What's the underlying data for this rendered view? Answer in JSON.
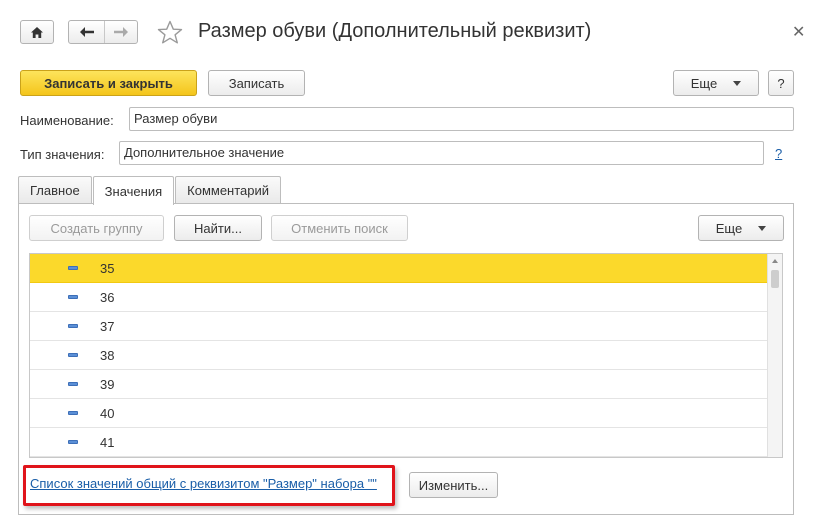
{
  "window": {
    "title": "Размер обуви (Дополнительный реквизит)"
  },
  "toolbar": {
    "save_close_label": "Записать и закрыть",
    "save_label": "Записать",
    "more_label": "Еще",
    "help_label": "?"
  },
  "form": {
    "name_label": "Наименование:",
    "name_value": "Размер обуви",
    "type_label": "Тип значения:",
    "type_value": "Дополнительное значение",
    "type_help": "?"
  },
  "tabs": [
    {
      "label": "Главное"
    },
    {
      "label": "Значения"
    },
    {
      "label": "Комментарий"
    }
  ],
  "values_panel": {
    "create_group_label": "Создать группу",
    "find_label": "Найти...",
    "cancel_search_label": "Отменить поиск",
    "more_label": "Еще",
    "rows": [
      "35",
      "36",
      "37",
      "38",
      "39",
      "40",
      "41"
    ],
    "shared_link_text": "Список значений общий с реквизитом \"Размер\" набора \"\"",
    "change_label": "Изменить..."
  },
  "colors": {
    "accent": "#f4c51b",
    "selected_row": "#fbd92b",
    "link": "#1a5ea8",
    "highlight": "#e0141b"
  }
}
